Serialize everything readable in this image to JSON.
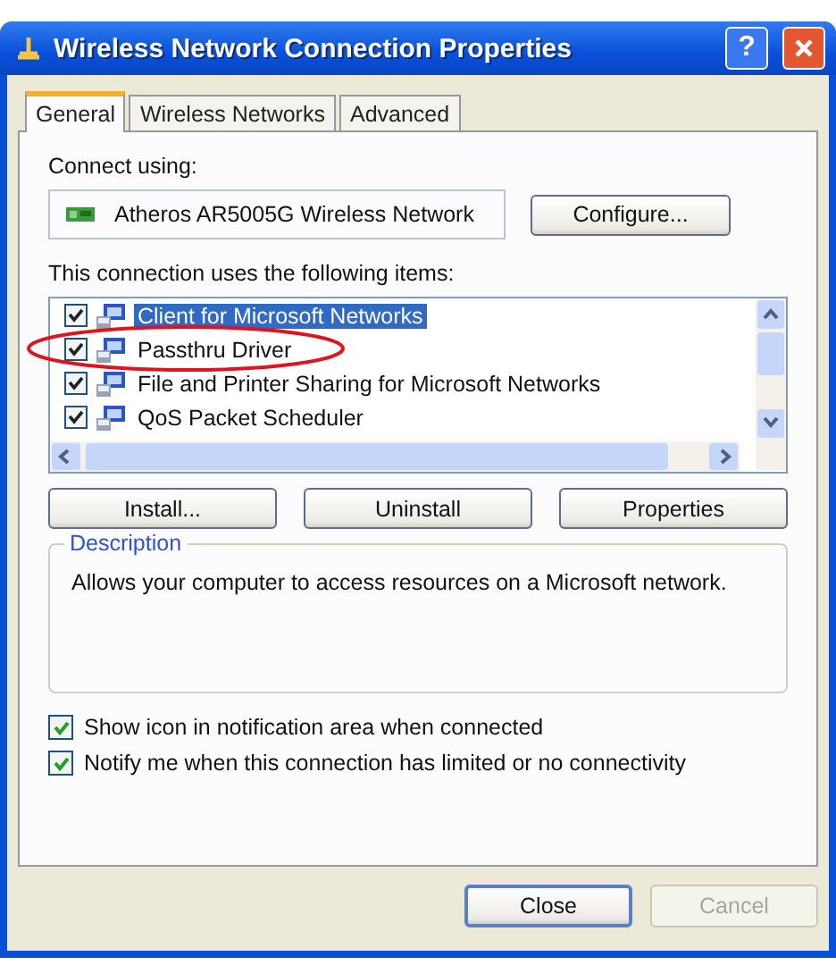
{
  "window": {
    "title": "Wireless Network Connection Properties",
    "help_label": "?"
  },
  "tabs": [
    {
      "label": "General",
      "selected": true
    },
    {
      "label": "Wireless Networks",
      "selected": false
    },
    {
      "label": "Advanced",
      "selected": false
    }
  ],
  "connect_using": {
    "label": "Connect using:",
    "adapter": "Atheros AR5005G Wireless Network",
    "button": "Configure..."
  },
  "items_label": "This connection uses the following items:",
  "items": [
    {
      "label": "Client for Microsoft Networks",
      "checked": true,
      "selected": true,
      "circled": false
    },
    {
      "label": "Passthru Driver",
      "checked": true,
      "selected": false,
      "circled": true
    },
    {
      "label": "File and Printer Sharing for Microsoft Networks",
      "checked": true,
      "selected": false,
      "circled": false
    },
    {
      "label": "QoS Packet Scheduler",
      "checked": true,
      "selected": false,
      "circled": false
    }
  ],
  "item_buttons": [
    "Install...",
    "Uninstall",
    "Properties"
  ],
  "description": {
    "title": "Description",
    "text": "Allows your computer to access resources on a Microsoft network."
  },
  "options": [
    {
      "label": "Show icon in notification area when connected",
      "checked": true
    },
    {
      "label": "Notify me when this connection has limited or no connectivity",
      "checked": true
    }
  ],
  "footer_buttons": [
    {
      "label": "Close",
      "default": true,
      "disabled": false
    },
    {
      "label": "Cancel",
      "default": false,
      "disabled": true
    }
  ]
}
